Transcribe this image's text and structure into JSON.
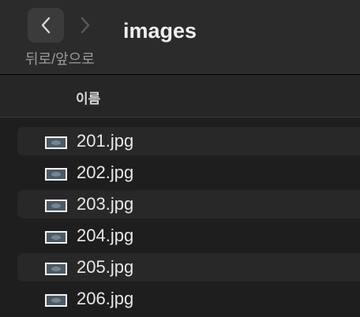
{
  "toolbar": {
    "title": "images",
    "nav_label": "뒤로/앞으로"
  },
  "list_header": {
    "name_column": "이름"
  },
  "files": [
    {
      "name": "201.jpg",
      "icon": "image-thumbnail-icon"
    },
    {
      "name": "202.jpg",
      "icon": "image-thumbnail-icon"
    },
    {
      "name": "203.jpg",
      "icon": "image-thumbnail-icon"
    },
    {
      "name": "204.jpg",
      "icon": "image-thumbnail-icon"
    },
    {
      "name": "205.jpg",
      "icon": "image-thumbnail-icon"
    },
    {
      "name": "206.jpg",
      "icon": "image-thumbnail-icon"
    }
  ],
  "colors": {
    "window_bg": "#1e1e1e",
    "toolbar_bg": "#2b2b2b",
    "stripe_bg": "#282828",
    "text": "#e8e8e8",
    "muted_text": "#9a9a9a"
  }
}
